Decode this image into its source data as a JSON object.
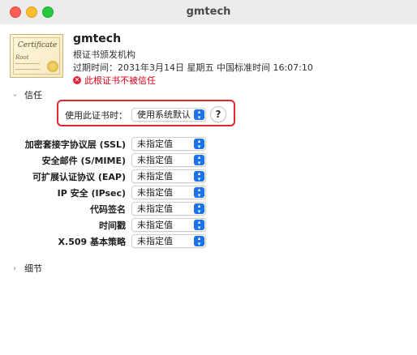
{
  "window": {
    "title": "gmtech"
  },
  "certificate": {
    "thumb_word": "Certificate",
    "thumb_root": "Root",
    "name": "gmtech",
    "kind": "根证书颁发机构",
    "expiry": "过期时间：2031年3月14日 星期五 中国标准时间 16:07:10",
    "status": "此根证书不被信任",
    "status_color": "#d70015"
  },
  "trust": {
    "section_label": "信任",
    "use_label": "使用此证书时：",
    "use_value": "使用系统默认",
    "help": "?",
    "highlight_color": "#e1262f",
    "rows": [
      {
        "label": "加密套接字协议层 (SSL)",
        "value": "未指定值"
      },
      {
        "label": "安全邮件 (S/MIME)",
        "value": "未指定值"
      },
      {
        "label": "可扩展认证协议 (EAP)",
        "value": "未指定值"
      },
      {
        "label": "IP 安全 (IPsec)",
        "value": "未指定值"
      },
      {
        "label": "代码签名",
        "value": "未指定值"
      },
      {
        "label": "时间戳",
        "value": "未指定值"
      },
      {
        "label": "X.509 基本策略",
        "value": "未指定值"
      }
    ]
  },
  "details": {
    "section_label": "细节"
  },
  "colors": {
    "accent": "#1a73e8"
  }
}
